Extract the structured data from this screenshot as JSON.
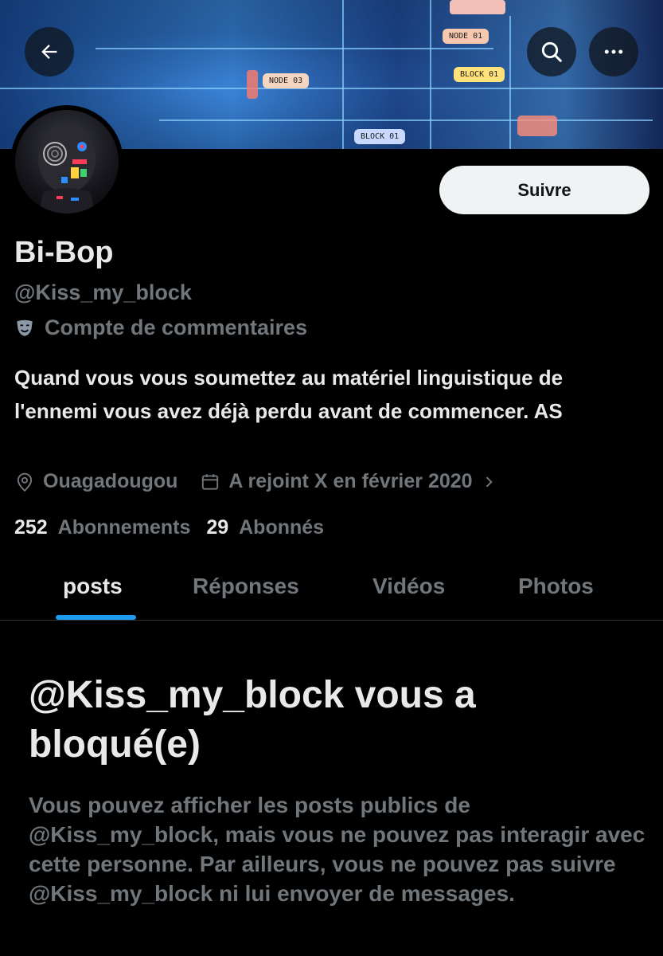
{
  "header": {
    "back_icon": "arrow-left-icon",
    "search_icon": "search-icon",
    "more_icon": "more-horizontal-icon",
    "banner_chips": [
      "NODE 03",
      "NODE 01",
      "BLOCK 01",
      "BLOCK 01"
    ]
  },
  "profile": {
    "follow_label": "Suivre",
    "name": "Bi-Bop",
    "handle": "@Kiss_my_block",
    "account_label_icon": "theater-mask-icon",
    "account_label": "Compte de commentaires",
    "bio": "Quand vous vous soumettez au matériel linguistique de l'ennemi vous avez déjà perdu avant de commencer. AS",
    "location_icon": "location-pin-icon",
    "location": "Ouagadougou",
    "joined_icon": "calendar-icon",
    "joined": "A rejoint X en février 2020",
    "following_count": "252",
    "following_label": "Abonnements",
    "followers_count": "29",
    "followers_label": "Abonnés"
  },
  "tabs": [
    {
      "label": "posts",
      "active": true
    },
    {
      "label": "Réponses",
      "active": false
    },
    {
      "label": "Vidéos",
      "active": false
    },
    {
      "label": "Photos",
      "active": false
    }
  ],
  "blocked": {
    "title": "@Kiss_my_block vous a bloqué(e)",
    "text": "Vous pouvez afficher les posts publics de @Kiss_my_block, mais vous ne pouvez pas interagir avec cette personne. Par ailleurs, vous ne pouvez pas suivre @Kiss_my_block ni lui envoyer de messages."
  },
  "colors": {
    "background": "#000000",
    "primary_text": "#e7e9ea",
    "secondary_text": "#71767b",
    "accent": "#1d9bf0",
    "follow_button_bg": "#eff3f4"
  }
}
